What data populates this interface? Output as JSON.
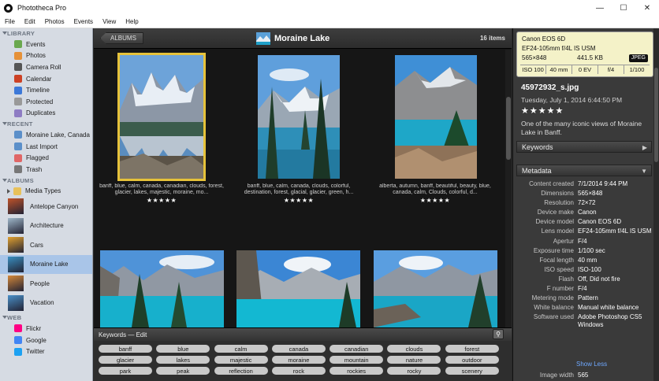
{
  "window": {
    "title": "Phototheca Pro",
    "controls": {
      "minimize": "—",
      "maximize": "☐",
      "close": "✕"
    }
  },
  "menu": [
    "File",
    "Edit",
    "Photos",
    "Events",
    "View",
    "Help"
  ],
  "sidebar": {
    "library_header": "LIBRARY",
    "library": [
      {
        "label": "Events",
        "icon": "events-icon",
        "color": "#6aa84f"
      },
      {
        "label": "Photos",
        "icon": "photos-icon",
        "color": "#e69138"
      },
      {
        "label": "Camera Roll",
        "icon": "camera-roll-icon",
        "color": "#555555"
      },
      {
        "label": "Calendar",
        "icon": "calendar-icon",
        "color": "#cc4125"
      },
      {
        "label": "Timeline",
        "icon": "timeline-icon",
        "color": "#3c78d8"
      },
      {
        "label": "Protected",
        "icon": "protected-icon",
        "color": "#999999"
      },
      {
        "label": "Duplicates",
        "icon": "duplicates-icon",
        "color": "#8e7cc3"
      }
    ],
    "recent_header": "RECENT",
    "recent": [
      {
        "label": "Moraine Lake, Canada",
        "icon": "recent-album-icon",
        "color": "#5b8fc9"
      },
      {
        "label": "Last Import",
        "icon": "last-import-icon",
        "color": "#5b8fc9"
      },
      {
        "label": "Flagged",
        "icon": "flagged-icon",
        "color": "#e06666"
      },
      {
        "label": "Trash",
        "icon": "trash-icon",
        "color": "#777777"
      }
    ],
    "albums_header": "ALBUMS",
    "media_types": "Media Types",
    "albums": [
      {
        "label": "Antelope Canyon",
        "color": "#c0532a"
      },
      {
        "label": "Architecture",
        "color": "#9fb7c9"
      },
      {
        "label": "Cars",
        "color": "#e0a030"
      },
      {
        "label": "Moraine Lake",
        "color": "#3a8fc0"
      },
      {
        "label": "People",
        "color": "#d4883a"
      },
      {
        "label": "Vacation",
        "color": "#4a90c8"
      }
    ],
    "web_header": "WEB",
    "web": [
      {
        "label": "Flickr",
        "icon": "flickr-icon",
        "color": "#ff0084"
      },
      {
        "label": "Google",
        "icon": "google-icon",
        "color": "#4285f4"
      },
      {
        "label": "Twitter",
        "icon": "twitter-icon",
        "color": "#1da1f2"
      }
    ]
  },
  "main": {
    "back_label": "ALBUMS",
    "album_title": "Moraine Lake",
    "count": "16 items",
    "photos": [
      {
        "caption": "banff, blue, calm, canada, canadian, clouds, forest, glacier, lakes, majestic, moraine, mo...",
        "stars": "★★★★★",
        "selected": true
      },
      {
        "caption": "banff, blue, calm, canada, clouds, colorful, destination, forest, glacial, glacier, green, h...",
        "stars": "★★★★★",
        "selected": false
      },
      {
        "caption": "alberta, autumn, banff, beautiful, beauty, blue, canada, calm, Clouds, colorful, d...",
        "stars": "★★★★★",
        "selected": false
      }
    ]
  },
  "keywords": {
    "title": "Keywords — Edit",
    "items": [
      "banff",
      "blue",
      "calm",
      "canada",
      "canadian",
      "clouds",
      "forest",
      "glacier",
      "lakes",
      "majestic",
      "moraine",
      "mountain",
      "nature",
      "outdoor",
      "park",
      "peak",
      "reflection",
      "rock",
      "rockies",
      "rocky",
      "scenery"
    ]
  },
  "inspector": {
    "camera": "Canon EOS 6D",
    "lens": "EF24-105mm f/4L IS USM",
    "dimensions": "565×848",
    "size": "441.5 KB",
    "format": "JPEG",
    "stats": [
      "ISO 100",
      "40 mm",
      "0 EV",
      "f/4",
      "1/100"
    ],
    "filename": "45972932_s.jpg",
    "date": "Tuesday, July 1, 2014 6:44:50 PM",
    "stars": "★★★★★",
    "description": "One of the many iconic views of Moraine Lake in Banff.",
    "keywords_label": "Keywords",
    "metadata_label": "Metadata",
    "metadata": [
      {
        "k": "Content created",
        "v": "7/1/2014 9:44 PM"
      },
      {
        "k": "Dimensions",
        "v": "565×848"
      },
      {
        "k": "Resolution",
        "v": "72×72"
      },
      {
        "k": "Device make",
        "v": "Canon"
      },
      {
        "k": "Device model",
        "v": "Canon EOS 6D"
      },
      {
        "k": "Lens model",
        "v": "EF24-105mm f/4L IS USM"
      },
      {
        "k": "Apertur",
        "v": "F/4"
      },
      {
        "k": "Exposure time",
        "v": "1/100 sec"
      },
      {
        "k": "Focal length",
        "v": "40 mm"
      },
      {
        "k": "ISO speed",
        "v": "ISO-100"
      },
      {
        "k": "Flash",
        "v": "Off, Did not fire"
      },
      {
        "k": "F number",
        "v": "F/4"
      },
      {
        "k": "Metering mode",
        "v": "Pattern"
      },
      {
        "k": "White balance",
        "v": "Manual white balance"
      },
      {
        "k": "Software used",
        "v": "Adobe Photoshop CS5 Windows"
      }
    ],
    "show_less": "Show Less",
    "image_width_label": "Image width",
    "image_width": "565"
  }
}
